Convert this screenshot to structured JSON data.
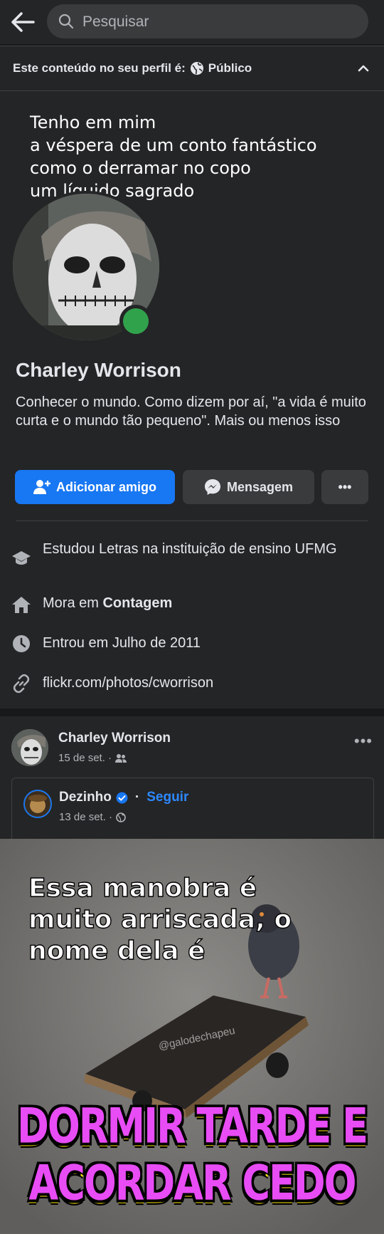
{
  "header": {
    "search_placeholder": "Pesquisar"
  },
  "privacy": {
    "label": "Este conteúdo no seu perfil é:",
    "value": "Público"
  },
  "profile": {
    "cover_quote": "Tenho em mim\na véspera de um conto fantástico\ncomo o derramar no copo\num líquido sagrado",
    "name": "Charley Worrison",
    "bio": "Conhecer o mundo. Como dizem por aí, \"a vida é muito curta e o mundo tão pequeno\". Mais ou menos isso",
    "online_color": "#31a24c",
    "buttons": {
      "add_friend": "Adicionar amigo",
      "message": "Mensagem",
      "more": "•••"
    },
    "details": [
      {
        "icon": "graduation-cap-icon",
        "text": "Estudou Letras na instituição de ensino UFMG"
      },
      {
        "icon": "home-icon",
        "prefix": "Mora em ",
        "bold": "Contagem"
      },
      {
        "icon": "clock-icon",
        "text": "Entrou em Julho de 2011"
      },
      {
        "icon": "link-icon",
        "text": "flickr.com/photos/cworrison"
      }
    ]
  },
  "post": {
    "author": "Charley Worrison",
    "date": "15 de set. ·",
    "more": "•••",
    "shared": {
      "author": "Dezinho",
      "follow_sep": "·",
      "follow": "Seguir",
      "date": "13 de set. ·"
    },
    "meme": {
      "top_lines": [
        "Essa manobra é",
        "muito arriscada, o",
        "nome dela é"
      ],
      "watermark": "@galodechapeu",
      "bottom_lines": [
        "DORMIR TARDE E",
        "ACORDAR CEDO"
      ]
    }
  },
  "colors": {
    "accent": "#1877f2",
    "link": "#2d88ff",
    "background": "#18191a",
    "surface": "#242526"
  }
}
